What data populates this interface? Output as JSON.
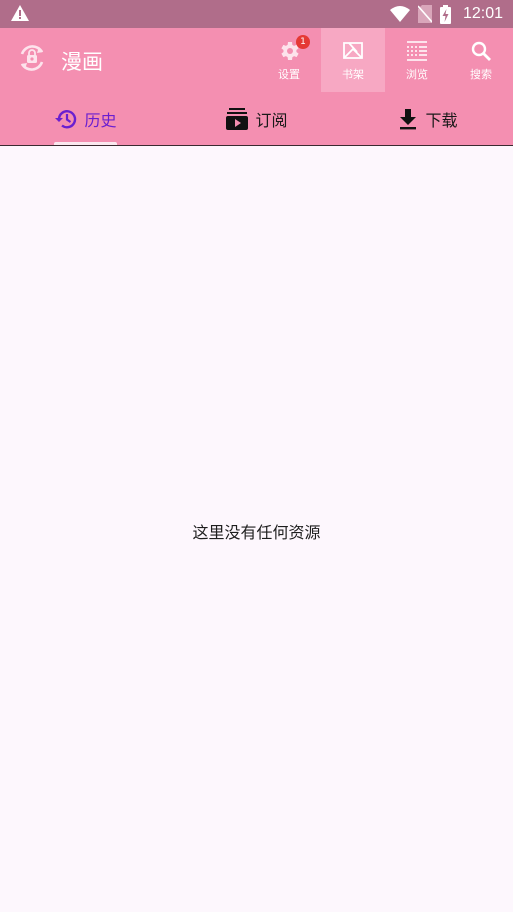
{
  "status_bar": {
    "time": "12:01",
    "icons": [
      "warning-icon",
      "wifi-icon",
      "no-sim-icon",
      "battery-charging-icon"
    ]
  },
  "app_bar": {
    "title": "漫画",
    "logo_icon": "rotate-logo-icon",
    "actions": [
      {
        "label": "设置",
        "icon": "settings-icon",
        "badge": "1"
      },
      {
        "label": "书架",
        "icon": "bookshelf-icon",
        "selected": true
      },
      {
        "label": "浏览",
        "icon": "browse-icon"
      },
      {
        "label": "搜索",
        "icon": "search-icon"
      }
    ]
  },
  "tabs": [
    {
      "label": "历史",
      "icon": "history-icon",
      "active": true
    },
    {
      "label": "订阅",
      "icon": "subscriptions-icon"
    },
    {
      "label": "下载",
      "icon": "download-icon"
    }
  ],
  "content": {
    "empty_message": "这里没有任何资源"
  },
  "colors": {
    "status_bar": "#b06d8a",
    "app_bar": "#f48fb1",
    "selected_action": "#f7a8c3",
    "active_tab": "#6a1fd0",
    "background": "#fdf7fd",
    "badge": "#e53935"
  }
}
